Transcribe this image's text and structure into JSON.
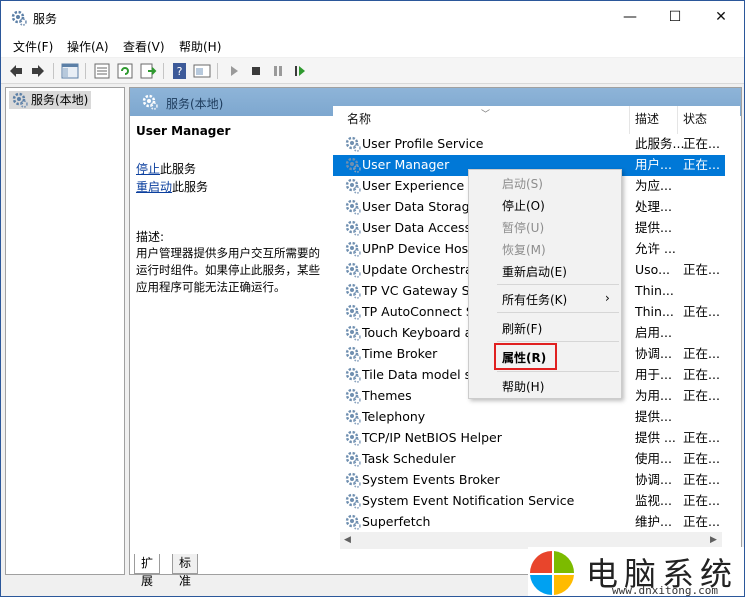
{
  "window": {
    "title": "服务",
    "controls": {
      "minimize": "—",
      "maximize": "☐",
      "close": "✕"
    }
  },
  "menu": [
    "文件(F)",
    "操作(A)",
    "查看(V)",
    "帮助(H)"
  ],
  "toolbar_icons": [
    "back-icon",
    "forward-icon",
    "show-hide-tree-icon",
    "properties-icon",
    "refresh-icon",
    "export-icon",
    "help-icon",
    "console-icon",
    "start-icon",
    "stop-icon",
    "pause-icon",
    "restart-icon"
  ],
  "tree": {
    "root": "服务(本地)"
  },
  "panel": {
    "header": "服务(本地)",
    "service_title": "User Manager",
    "stop_link": "停止",
    "stop_suffix": "此服务",
    "restart_link": "重启动",
    "restart_suffix": "此服务",
    "desc_label": "描述:",
    "desc_text": "用户管理器提供多用户交互所需要的运行时组件。如果停止此服务，某些应用程序可能无法正确运行。"
  },
  "list": {
    "columns": {
      "name": "名称",
      "description": "描述",
      "status": "状态"
    },
    "rows": [
      {
        "name": "User Profile Service",
        "desc": "此服务...",
        "status": "正在..."
      },
      {
        "name": "User Manager",
        "desc": "用户...",
        "status": "正在...",
        "selected": true
      },
      {
        "name": "User Experience V",
        "desc": "为应...",
        "status": ""
      },
      {
        "name": "User Data Storag",
        "desc": "处理...",
        "status": ""
      },
      {
        "name": "User Data Access",
        "desc": "提供...",
        "status": ""
      },
      {
        "name": "UPnP Device Host",
        "desc": "允许 ...",
        "status": ""
      },
      {
        "name": "Update Orchestra",
        "desc": "Uso...",
        "status": "正在..."
      },
      {
        "name": "TP VC Gateway Se",
        "desc": "Thin...",
        "status": ""
      },
      {
        "name": "TP AutoConnect S",
        "desc": "Thin...",
        "status": "正在..."
      },
      {
        "name": "Touch Keyboard a",
        "desc": "启用...",
        "status": ""
      },
      {
        "name": "Time Broker",
        "desc": "协调...",
        "status": "正在..."
      },
      {
        "name": "Tile Data model s",
        "desc": "用于...",
        "status": "正在..."
      },
      {
        "name": "Themes",
        "desc": "为用...",
        "status": "正在..."
      },
      {
        "name": "Telephony",
        "desc": "提供...",
        "status": ""
      },
      {
        "name": "TCP/IP NetBIOS Helper",
        "desc": "提供 ...",
        "status": "正在..."
      },
      {
        "name": "Task Scheduler",
        "desc": "使用...",
        "status": "正在..."
      },
      {
        "name": "System Events Broker",
        "desc": "协调...",
        "status": "正在..."
      },
      {
        "name": "System Event Notification Service",
        "desc": "监视...",
        "status": "正在..."
      },
      {
        "name": "Superfetch",
        "desc": "维护...",
        "status": "正在..."
      }
    ]
  },
  "tabs": {
    "extended": "扩展",
    "standard": "标准"
  },
  "context_menu": {
    "start": "启动(S)",
    "stop": "停止(O)",
    "pause": "暂停(U)",
    "resume": "恢复(M)",
    "restart": "重新启动(E)",
    "all_tasks": "所有任务(K)",
    "refresh": "刷新(F)",
    "properties": "属性(R)",
    "help": "帮助(H)"
  },
  "watermark": {
    "text": "电脑系统",
    "url": "www.dnxitong.com"
  },
  "colors": {
    "selection": "#0078d7",
    "header_gradient": "#8eb4d8",
    "highlight_box": "#e02020",
    "link": "#0b3f9e"
  }
}
